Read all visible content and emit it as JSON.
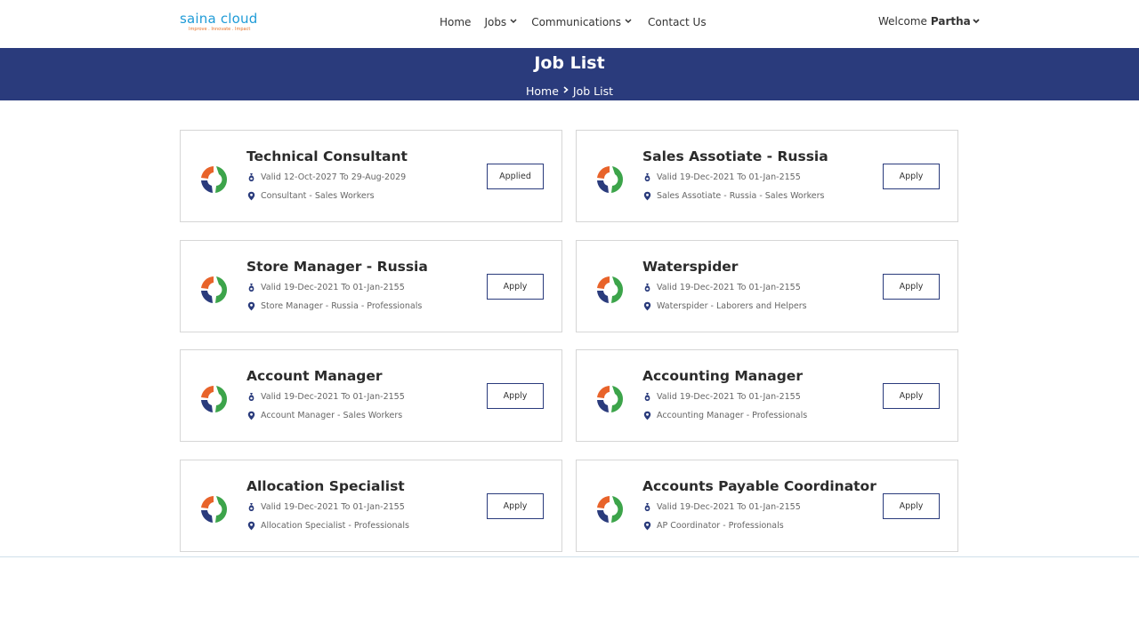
{
  "header": {
    "logo_name": "saina cloud",
    "logo_tagline": "Improve . Innovate . Impact",
    "nav": [
      {
        "label": "Home"
      },
      {
        "label": "Jobs"
      },
      {
        "label": "Communications"
      },
      {
        "label": "Contact Us"
      }
    ],
    "welcome_text": "Welcome",
    "user_name": "Partha"
  },
  "banner": {
    "title": "Job List",
    "breadcrumb": [
      "Home",
      "Job List"
    ]
  },
  "jobs": [
    {
      "title": "Technical Consultant",
      "valid": "Valid 12-Oct-2027 To 29-Aug-2029",
      "location": "Consultant - Sales Workers",
      "action": "Applied"
    },
    {
      "title": "Sales Assotiate - Russia",
      "valid": "Valid 19-Dec-2021 To 01-Jan-2155",
      "location": "Sales Assotiate - Russia - Sales Workers",
      "action": "Apply"
    },
    {
      "title": "Store Manager - Russia",
      "valid": "Valid 19-Dec-2021 To 01-Jan-2155",
      "location": "Store Manager - Russia - Professionals",
      "action": "Apply"
    },
    {
      "title": "Waterspider",
      "valid": "Valid 19-Dec-2021 To 01-Jan-2155",
      "location": "Waterspider - Laborers and Helpers",
      "action": "Apply"
    },
    {
      "title": "Account Manager",
      "valid": "Valid 19-Dec-2021 To 01-Jan-2155",
      "location": "Account Manager - Sales Workers",
      "action": "Apply"
    },
    {
      "title": "Accounting Manager",
      "valid": "Valid 19-Dec-2021 To 01-Jan-2155",
      "location": "Accounting Manager - Professionals",
      "action": "Apply"
    },
    {
      "title": "Allocation Specialist",
      "valid": "Valid 19-Dec-2021 To 01-Jan-2155",
      "location": "Allocation Specialist - Professionals",
      "action": "Apply"
    },
    {
      "title": "Accounts Payable Coordinator",
      "valid": "Valid 19-Dec-2021 To 01-Jan-2155",
      "location": "AP Coordinator - Professionals",
      "action": "Apply"
    }
  ],
  "colors": {
    "banner": "#2a3b7c",
    "logo_blue": "#1f9bd7",
    "logo_orange": "#e8732a"
  }
}
